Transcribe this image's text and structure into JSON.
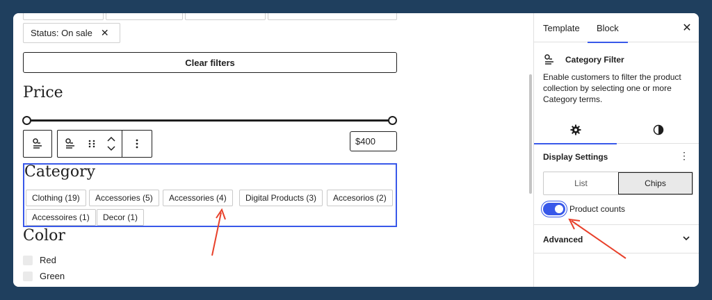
{
  "canvas": {
    "status_chip": {
      "label": "Status: On sale",
      "remove": "✕"
    },
    "clear_filters": "Clear filters",
    "price": {
      "heading": "Price",
      "max_value": "$400"
    },
    "category": {
      "heading": "Category",
      "chips": [
        "Clothing (19)",
        "Accessories (5)",
        "Accessories (4)",
        "Digital Products (3)",
        "Accesorios (2)",
        "Accessoires (1)",
        "Decor (1)"
      ]
    },
    "color": {
      "heading": "Color",
      "options": [
        "Red",
        "Green"
      ]
    }
  },
  "sidebar": {
    "tabs": [
      "Template",
      "Block"
    ],
    "active_tab": "Block",
    "close": "✕",
    "block": {
      "title": "Category Filter",
      "description": "Enable customers to filter the product collection by selecting one or more Category terms."
    },
    "display_settings": {
      "title": "Display Settings",
      "more": "⋮",
      "styles": [
        "List",
        "Chips"
      ],
      "active_style": "Chips",
      "product_counts_label": "Product counts",
      "product_counts_enabled": true
    },
    "advanced": "Advanced"
  },
  "colors": {
    "background": "#1f3f5e",
    "accent": "#3858e9",
    "annotation_arrow": "#e8402a"
  }
}
